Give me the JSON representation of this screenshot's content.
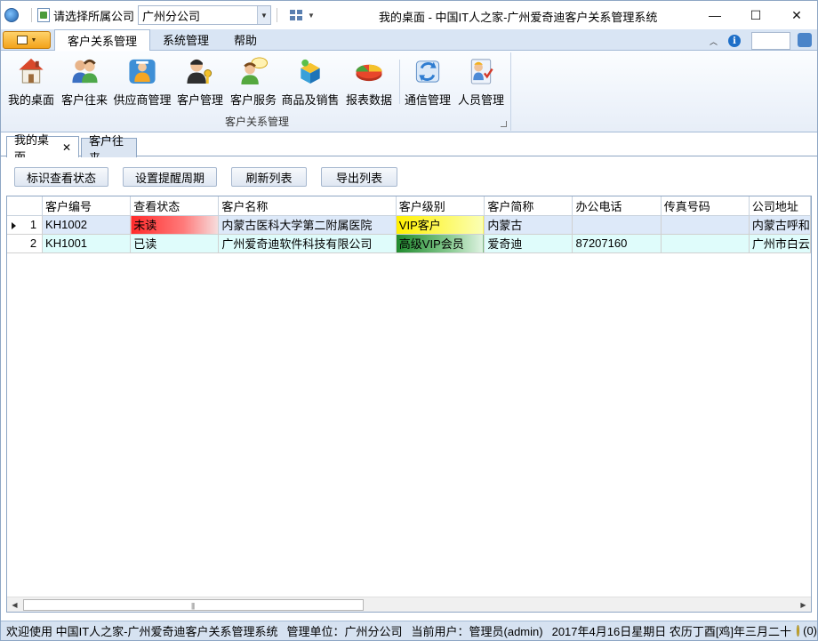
{
  "titlebar": {
    "company_label": "请选择所属公司",
    "company_value": "广州分公司",
    "window_title": "我的桌面 - 中国IT人之家-广州爱奇迪客户关系管理系统",
    "min_glyph": "—",
    "max_glyph": "☐",
    "close_glyph": "✕"
  },
  "ribbon_tabs": [
    "客户关系管理",
    "系统管理",
    "帮助"
  ],
  "ribbon": {
    "buttons": [
      {
        "label": "我的桌面",
        "icon": "house-icon"
      },
      {
        "label": "客户往来",
        "icon": "people-icon"
      },
      {
        "label": "供应商管理",
        "icon": "supplier-icon"
      },
      {
        "label": "客户管理",
        "icon": "user-key-icon"
      },
      {
        "label": "客户服务",
        "icon": "user-chat-icon"
      },
      {
        "label": "商品及销售",
        "icon": "goods-icon"
      },
      {
        "label": "报表数据",
        "icon": "pie-chart-icon"
      },
      {
        "label": "通信管理",
        "icon": "sync-icon"
      },
      {
        "label": "人员管理",
        "icon": "staff-icon"
      }
    ],
    "group_label": "客户关系管理"
  },
  "doc_tabs": {
    "active": "我的桌面",
    "close_glyph": "✕",
    "inactive": "客户往来"
  },
  "toolbar": {
    "mark_status": "标识查看状态",
    "set_reminder": "设置提醒周期",
    "refresh": "刷新列表",
    "export": "导出列表"
  },
  "grid": {
    "columns": [
      "客户编号",
      "查看状态",
      "客户名称",
      "客户级别",
      "客户简称",
      "办公电话",
      "传真号码",
      "公司地址"
    ],
    "rows": [
      {
        "num": "1",
        "id": "KH1002",
        "status": "未读",
        "name": "内蒙古医科大学第二附属医院",
        "level": "VIP客户",
        "short": "内蒙古",
        "phone": "",
        "fax": "",
        "address": "内蒙古呼和"
      },
      {
        "num": "2",
        "id": "KH1001",
        "status": "已读",
        "name": "广州爱奇迪软件科技有限公司",
        "level": "高级VIP会员",
        "short": "爱奇迪",
        "phone": "87207160",
        "fax": "",
        "address": "广州市白云"
      }
    ],
    "scroll_grip": "|||"
  },
  "statusbar": {
    "welcome": "欢迎使用 中国IT人之家-广州爱奇迪客户关系管理系统",
    "unit": "管理单位：广州分公司",
    "user": "当前用户：管理员(admin)",
    "date": "2017年4月16日星期日 农历丁酉[鸡]年三月二十",
    "count": "(0)"
  },
  "colors": {
    "accent": "#d9e5f4",
    "unread": "#ff2a2a",
    "vip": "#fff000",
    "high_vip": "#1e8a2c"
  }
}
